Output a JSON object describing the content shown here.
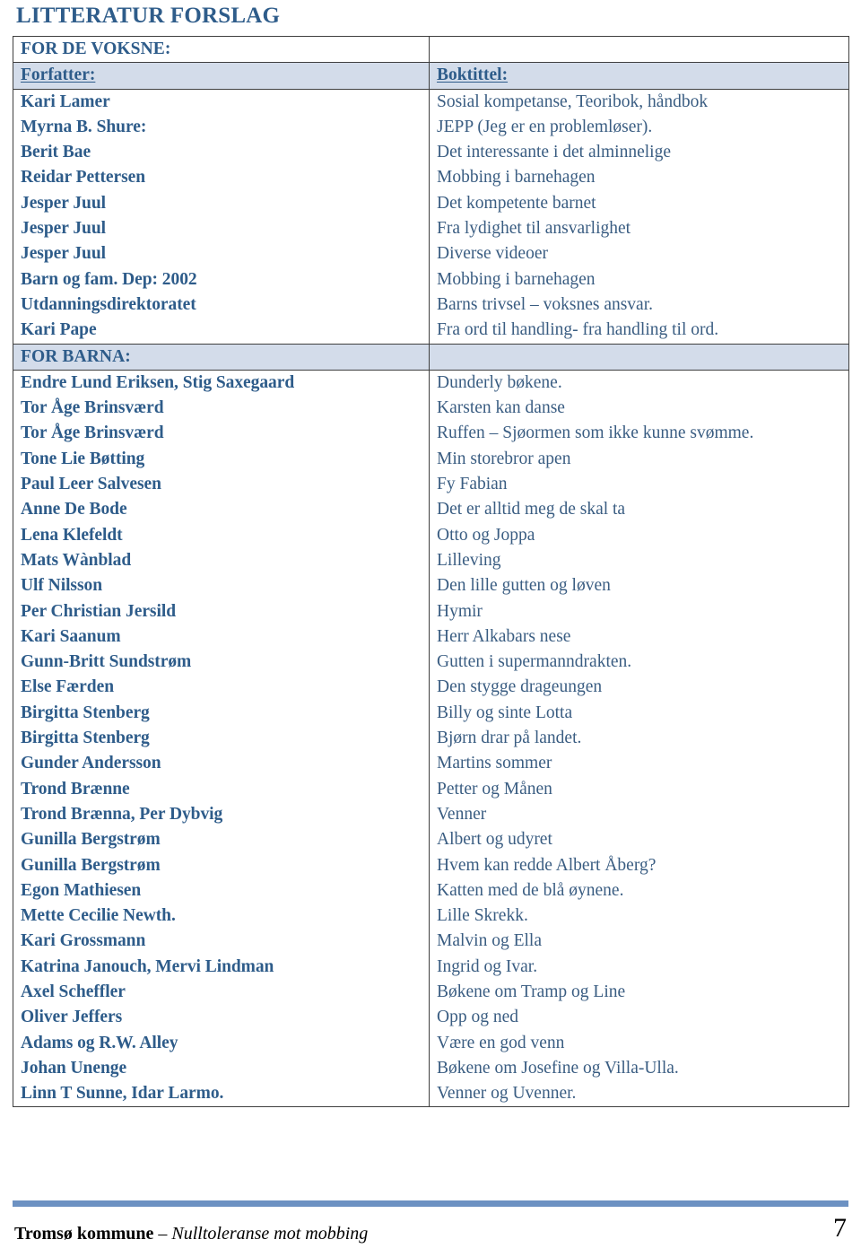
{
  "document": {
    "title": "LITTERATUR FORSLAG",
    "accent_color": "#2e5c8a",
    "band_color": "#d3dcea",
    "rule_color": "#6c91c2"
  },
  "table": {
    "section_adults_label": "FOR DE VOKSNE:",
    "section_children_label": "FOR BARNA:",
    "header_author": "Forfatter:",
    "header_title": "Boktittel:",
    "adults": {
      "authors": [
        "Kari Lamer",
        "Myrna B. Shure:",
        "Berit Bae",
        "Reidar Pettersen",
        "Jesper Juul",
        "Jesper Juul",
        "Jesper Juul",
        "Barn og fam. Dep: 2002",
        "Utdanningsdirektoratet",
        "Kari Pape"
      ],
      "titles": [
        "Sosial kompetanse, Teoribok, håndbok",
        "JEPP (Jeg er en problemløser).",
        "Det interessante i det alminnelige",
        "Mobbing i barnehagen",
        "Det kompetente barnet",
        "Fra lydighet til ansvarlighet",
        "Diverse videoer",
        "Mobbing i barnehagen",
        "Barns trivsel – voksnes ansvar.",
        "Fra ord til handling- fra handling til ord."
      ]
    },
    "children": {
      "authors": [
        "Endre Lund Eriksen, Stig Saxegaard",
        "Tor Åge Brinsværd",
        "Tor Åge Brinsværd",
        "Tone Lie Bøtting",
        "Paul Leer Salvesen",
        "Anne De Bode",
        "Lena Klefeldt",
        "Mats Wànblad",
        "Ulf Nilsson",
        "Per Christian Jersild",
        "Kari Saanum",
        "Gunn-Britt Sundstrøm",
        "Else Færden",
        "Birgitta Stenberg",
        "Birgitta Stenberg",
        "Gunder Andersson",
        "Trond Brænne",
        "Trond Brænna, Per Dybvig",
        "Gunilla Bergstrøm",
        "Gunilla Bergstrøm",
        "Egon Mathiesen",
        "Mette Cecilie Newth.",
        "Kari Grossmann",
        "Katrina Janouch, Mervi Lindman",
        "Axel Scheffler",
        "Oliver Jeffers",
        "Adams og R.W. Alley",
        "Johan Unenge",
        "Linn T Sunne, Idar Larmo."
      ],
      "titles": [
        "Dunderly bøkene.",
        "Karsten kan danse",
        "Ruffen – Sjøormen som ikke kunne svømme.",
        "Min storebror apen",
        "Fy Fabian",
        "Det er alltid meg de skal ta",
        "Otto og Joppa",
        "Lilleving",
        "Den lille gutten og løven",
        "Hymir",
        "Herr Alkabars nese",
        "Gutten i supermanndrakten.",
        "Den stygge drageungen",
        "Billy og sinte Lotta",
        "Bjørn drar på landet.",
        "Martins sommer",
        "Petter og Månen",
        "Venner",
        "Albert og udyret",
        "Hvem kan redde Albert Åberg?",
        "Katten med de blå øynene.",
        "Lille Skrekk.",
        "Malvin og Ella",
        "Ingrid og Ivar.",
        "Bøkene om Tramp og Line",
        "Opp og ned",
        "Være en god venn",
        "Bøkene om Josefine og Villa-Ulla.",
        "Venner og Uvenner."
      ]
    }
  },
  "footer": {
    "organization": "Tromsø kommune",
    "separator": " – ",
    "tagline": "Nulltoleranse mot mobbing",
    "page_number": "7"
  }
}
